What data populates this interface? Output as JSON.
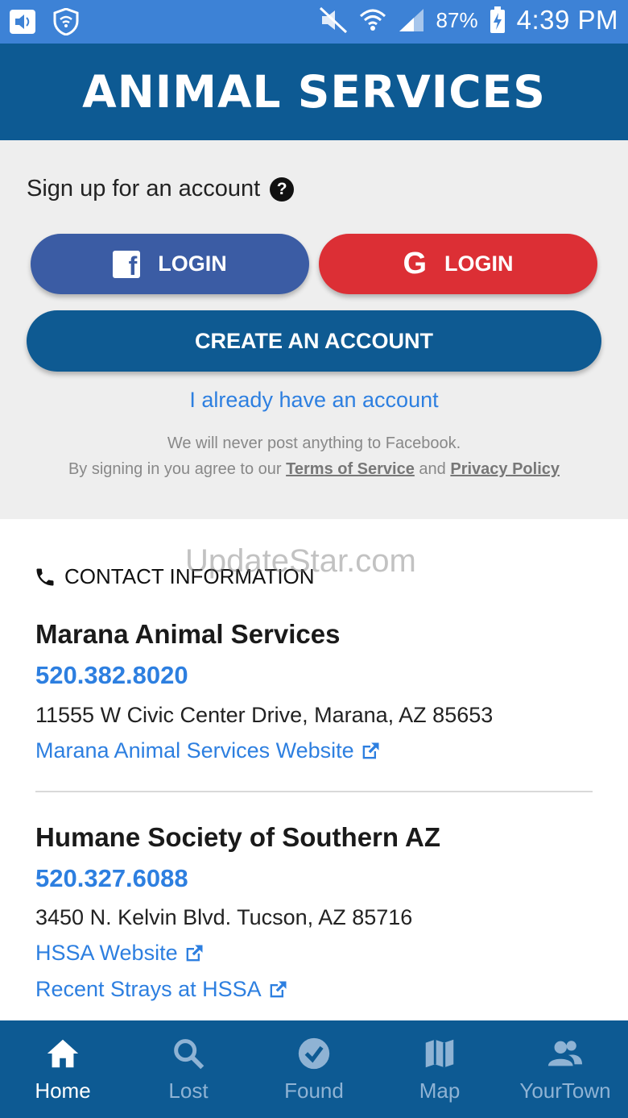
{
  "status_bar": {
    "battery": "87%",
    "time": "4:39 PM"
  },
  "header": {
    "title": "ANIMAL SERVICES"
  },
  "signup": {
    "prompt": "Sign up for an account",
    "facebook_login": "LOGIN",
    "google_login": "LOGIN",
    "create_account": "CREATE AN ACCOUNT",
    "already_have": "I already have an account",
    "legal_line1": "We will never post anything to Facebook.",
    "legal_prefix": "By signing in you agree to our",
    "terms": "Terms of Service",
    "and": "and",
    "privacy": "Privacy Policy"
  },
  "watermark": "UpdateStar.com",
  "contact": {
    "heading": "CONTACT INFORMATION",
    "orgs": [
      {
        "name": "Marana Animal Services",
        "phone": "520.382.8020",
        "address": "11555 W Civic Center Drive, Marana, AZ 85653",
        "links": [
          "Marana Animal Services Website"
        ]
      },
      {
        "name": "Humane Society of Southern AZ",
        "phone": "520.327.6088",
        "address": "3450 N. Kelvin Blvd. Tucson, AZ 85716",
        "links": [
          "HSSA Website",
          "Recent Strays at HSSA"
        ]
      }
    ]
  },
  "nav": [
    {
      "label": "Home",
      "icon": "home-icon",
      "active": true
    },
    {
      "label": "Lost",
      "icon": "search-icon",
      "active": false
    },
    {
      "label": "Found",
      "icon": "check-circle-icon",
      "active": false
    },
    {
      "label": "Map",
      "icon": "map-icon",
      "active": false
    },
    {
      "label": "YourTown",
      "icon": "people-icon",
      "active": false
    }
  ],
  "colors": {
    "status_bar": "#3d82d6",
    "primary": "#0d5a93",
    "facebook": "#3b5ca4",
    "google": "#dc2f35",
    "link": "#2d7fe0"
  }
}
